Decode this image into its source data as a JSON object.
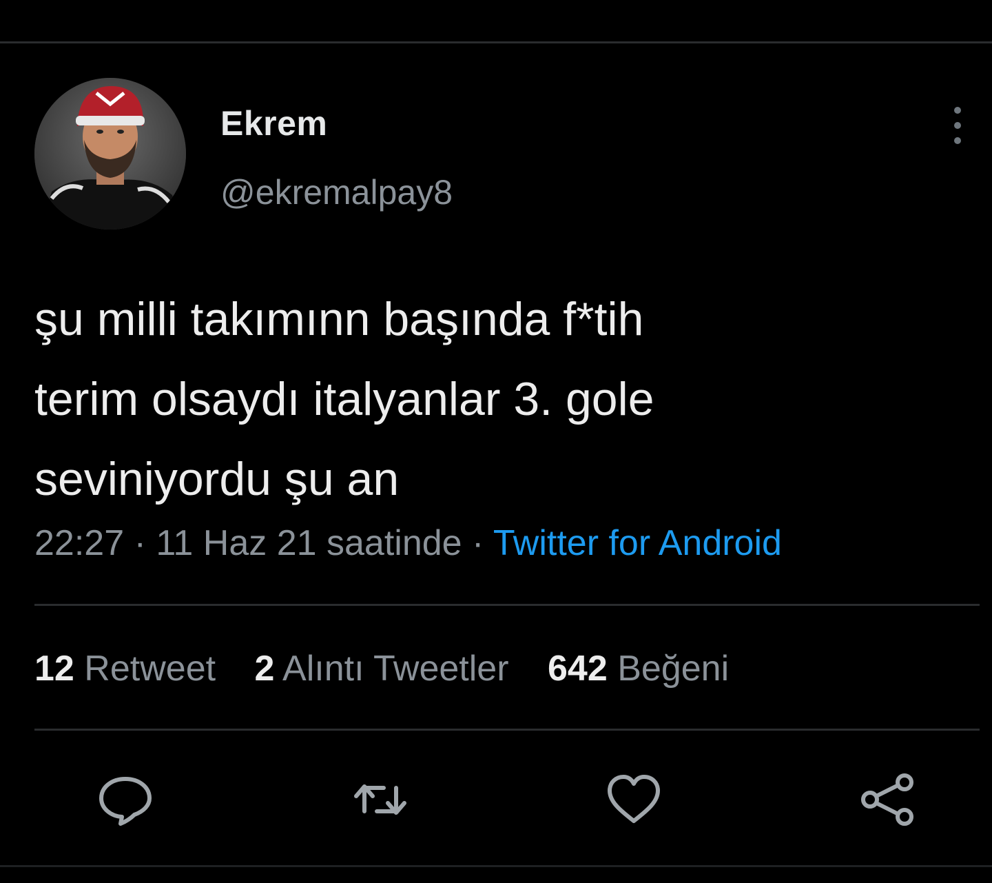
{
  "tweet": {
    "author": {
      "display_name": "Ekrem",
      "handle": "@ekremalpay8"
    },
    "text": "şu milli takımınn başında f*tih\nterim olsaydı italyanlar 3. gole\nseviniyordu şu an",
    "meta": {
      "time": "22:27",
      "separator": " · ",
      "date_text": "11 Haz 21 saatinde",
      "source": "Twitter for Android"
    },
    "stats": [
      {
        "count": "12",
        "label": "Retweet"
      },
      {
        "count": "2",
        "label": "Alıntı Tweetler"
      },
      {
        "count": "642",
        "label": "Beğeni"
      }
    ],
    "actions": [
      "reply-icon",
      "retweet-icon",
      "like-icon",
      "share-icon"
    ]
  },
  "colors": {
    "background": "#000000",
    "text_primary": "#e7e9ea",
    "text_secondary": "#8b9299",
    "link": "#1d9bf0",
    "divider": "#2a2c2e"
  }
}
